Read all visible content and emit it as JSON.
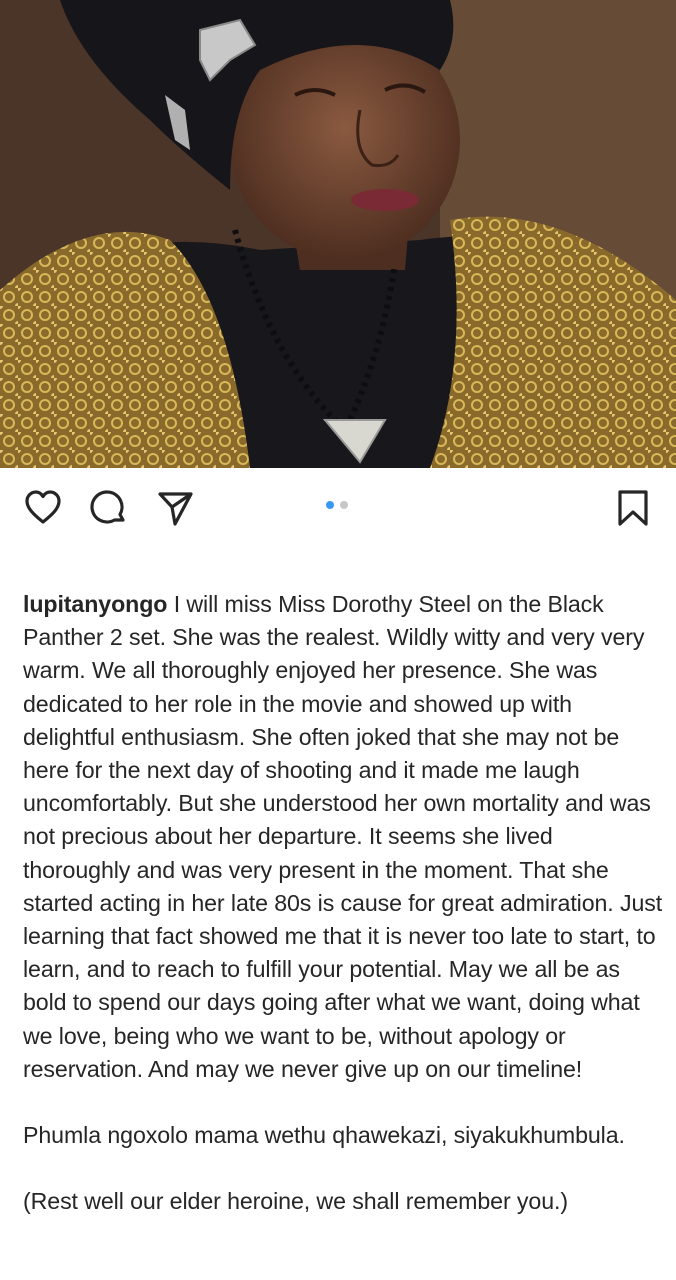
{
  "post": {
    "photo": {
      "subject": "elderly woman in dark head wrap and gold lace shawl with beaded necklace and silver pendant",
      "colors": {
        "background": "#5a3e30",
        "wrap": "#15151a",
        "gold": "#b8963e",
        "skin": "#6b4330"
      }
    },
    "actions": {
      "like_icon": "heart-icon",
      "comment_icon": "comment-icon",
      "share_icon": "send-icon",
      "save_icon": "bookmark-icon"
    },
    "carousel": {
      "count": 2,
      "active": 1,
      "active_color": "#3897f0",
      "inactive_color": "#c7c7c7"
    },
    "caption": {
      "username": "lupitanyongo",
      "text": " I will miss Miss Dorothy Steel on the Black Panther 2 set. She was the realest. Wildly witty and very very warm. We all thoroughly enjoyed her presence. She was dedicated to her role in the movie and showed up with delightful enthusiasm. She often joked that she may not be here for the next day of shooting and it made me laugh uncomfortably. But she understood her own mortality and was not precious about her departure. It seems she lived thoroughly and was very present in the moment. That she started acting in her late 80s is cause for great admiration. Just learning that fact showed me that it is never too late to start, to learn, and to reach to fulfill your potential. May we all be as bold to spend our days going after what we want, doing what we love, being who we want to be, without apology or reservation. And may we never give up on our timeline!",
      "paragraph2": "Phumla ngoxolo mama wethu qhawekazi, siyakukhumbula.",
      "paragraph3": "(Rest well our elder heroine, we shall remember you.)"
    }
  }
}
